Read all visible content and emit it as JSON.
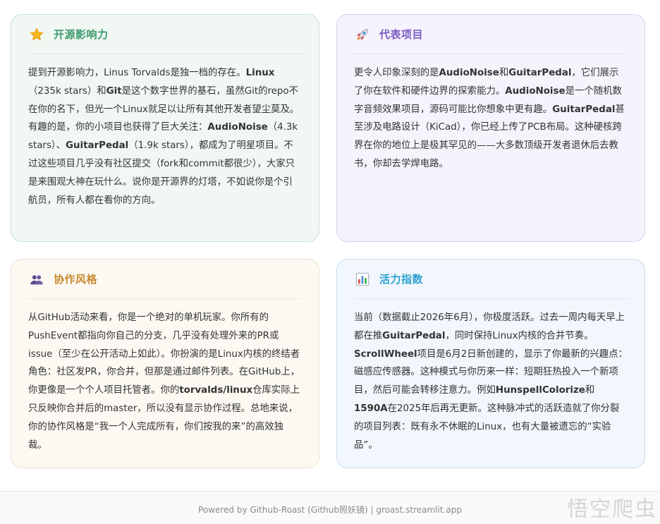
{
  "colors": {
    "influence_title": "#3d9a6e",
    "projects_title": "#7b5cc4",
    "collab_title": "#c98a2e",
    "activity_title": "#2a9fd0"
  },
  "cards": [
    {
      "icon": "star-icon",
      "title": "开源影响力",
      "segments": [
        {
          "t": "提到开源影响力，Linus Torvalds是独一档的存在。"
        },
        {
          "t": "Linux",
          "b": true
        },
        {
          "t": "（235k stars）和"
        },
        {
          "t": "Git",
          "b": true
        },
        {
          "t": "是这个数字世界的基石，虽然Git的repo不在你的名下，但光一个Linux就足以让所有其他开发者望尘莫及。有趣的是，你的小项目也获得了巨大关注："
        },
        {
          "t": "AudioNoise",
          "b": true
        },
        {
          "t": "（4.3k stars）、"
        },
        {
          "t": "GuitarPedal",
          "b": true
        },
        {
          "t": "（1.9k stars），都成为了明星项目。不过这些项目几乎没有社区提交（fork和commit都很少），大家只是来围观大神在玩什么。说你是开源界的灯塔，不如说你是个引航员，所有人都在看你的方向。"
        }
      ]
    },
    {
      "icon": "rocket-icon",
      "title": "代表项目",
      "segments": [
        {
          "t": "更令人印象深刻的是"
        },
        {
          "t": "AudioNoise",
          "b": true
        },
        {
          "t": "和"
        },
        {
          "t": "GuitarPedal",
          "b": true
        },
        {
          "t": "，它们展示了你在软件和硬件边界的探索能力。"
        },
        {
          "t": "AudioNoise",
          "b": true
        },
        {
          "t": "是一个随机数字音频效果项目，源码可能比你想象中更有趣。"
        },
        {
          "t": "GuitarPedal",
          "b": true
        },
        {
          "t": "甚至涉及电路设计（KiCad），你已经上传了PCB布局。这种硬核跨界在你的地位上是极其罕见的——大多数顶级开发者退休后去教书，你却去学焊电路。"
        }
      ]
    },
    {
      "icon": "people-icon",
      "title": "协作风格",
      "segments": [
        {
          "t": "从GitHub活动来看，你是一个绝对的单机玩家。你所有的PushEvent都指向你自己的分支，几乎没有处理外来的PR或issue（至少在公开活动上如此）。你扮演的是Linux内核的终结者角色：社区发PR，你合并，但那是通过邮件列表。在GitHub上，你更像是一个个人项目托管者。你的"
        },
        {
          "t": "torvalds/linux",
          "b": true
        },
        {
          "t": "仓库实际上只反映你合并后的master，所以没有显示协作过程。总地来说，你的协作风格是“我一个人完成所有，你们按我的来”的高效独裁。"
        }
      ]
    },
    {
      "icon": "bar-chart-icon",
      "title": "活力指数",
      "segments": [
        {
          "t": "当前（数据截止2026年6月），你极度活跃。过去一周内每天早上都在推"
        },
        {
          "t": "GuitarPedal",
          "b": true
        },
        {
          "t": "，同时保持Linux内核的合并节奏。"
        },
        {
          "t": "ScrollWheel",
          "b": true
        },
        {
          "t": "项目是6月2日新创建的，显示了你最新的兴趣点：磁感应传感器。这种模式与你历来一样：短期狂热投入一个新项目，然后可能会转移注意力。例如"
        },
        {
          "t": "HunspellColorize",
          "b": true
        },
        {
          "t": "和"
        },
        {
          "t": "1590A",
          "b": true
        },
        {
          "t": "在2025年后再无更新。这种脉冲式的活跃造就了你分裂的项目列表：既有永不休眠的Linux，也有大量被遗忘的“实验品”。"
        }
      ]
    }
  ],
  "footer": {
    "text": "Powered by Github-Roast (Github照妖镜) | groast.streamlit.app"
  },
  "watermark": "悟空爬虫"
}
